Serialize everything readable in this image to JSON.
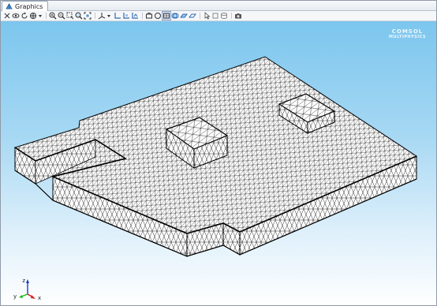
{
  "tab": {
    "title": "Graphics",
    "icon": "graphics-tab-icon"
  },
  "toolbar": {
    "buttons": [
      {
        "name": "select-icon"
      },
      {
        "name": "eye-icon"
      },
      {
        "name": "rotate-icon"
      },
      {
        "name": "pan-icon"
      },
      {
        "name": "dropdown-arrow-icon"
      },
      {
        "name": "zoom-in-icon"
      },
      {
        "name": "zoom-out-icon"
      },
      {
        "name": "zoom-box-icon"
      },
      {
        "name": "zoom-selected-icon"
      },
      {
        "name": "zoom-extents-icon"
      },
      {
        "name": "axis-view-icon"
      },
      {
        "name": "dropdown-arrow-icon"
      },
      {
        "name": "xy-plane-icon"
      },
      {
        "name": "yz-plane-icon"
      },
      {
        "name": "zx-plane-icon"
      },
      {
        "name": "go-to-default-view-icon"
      },
      {
        "name": "scene-light-icon"
      },
      {
        "name": "transparency-icon"
      },
      {
        "name": "wireframe-icon"
      },
      {
        "name": "select-boundaries-icon"
      },
      {
        "name": "select-edges-icon"
      },
      {
        "name": "select-points-icon"
      },
      {
        "name": "select-domains-icon"
      },
      {
        "name": "clear-selection-icon"
      },
      {
        "name": "snapshot-icon"
      }
    ],
    "active": "wireframe-icon"
  },
  "logo": {
    "line1": "COMSOL",
    "line2": "MULTIPHYSICS"
  },
  "axes": {
    "x": "x",
    "y": "y",
    "z": "z",
    "x_color": "#d42020",
    "y_color": "#1db81d",
    "z_color": "#1a3ccc"
  },
  "colors": {
    "background_top": "#7cc6ee",
    "background_bottom": "#ffffff",
    "mesh_face": "#ffffff",
    "mesh_edge": "#000000"
  }
}
